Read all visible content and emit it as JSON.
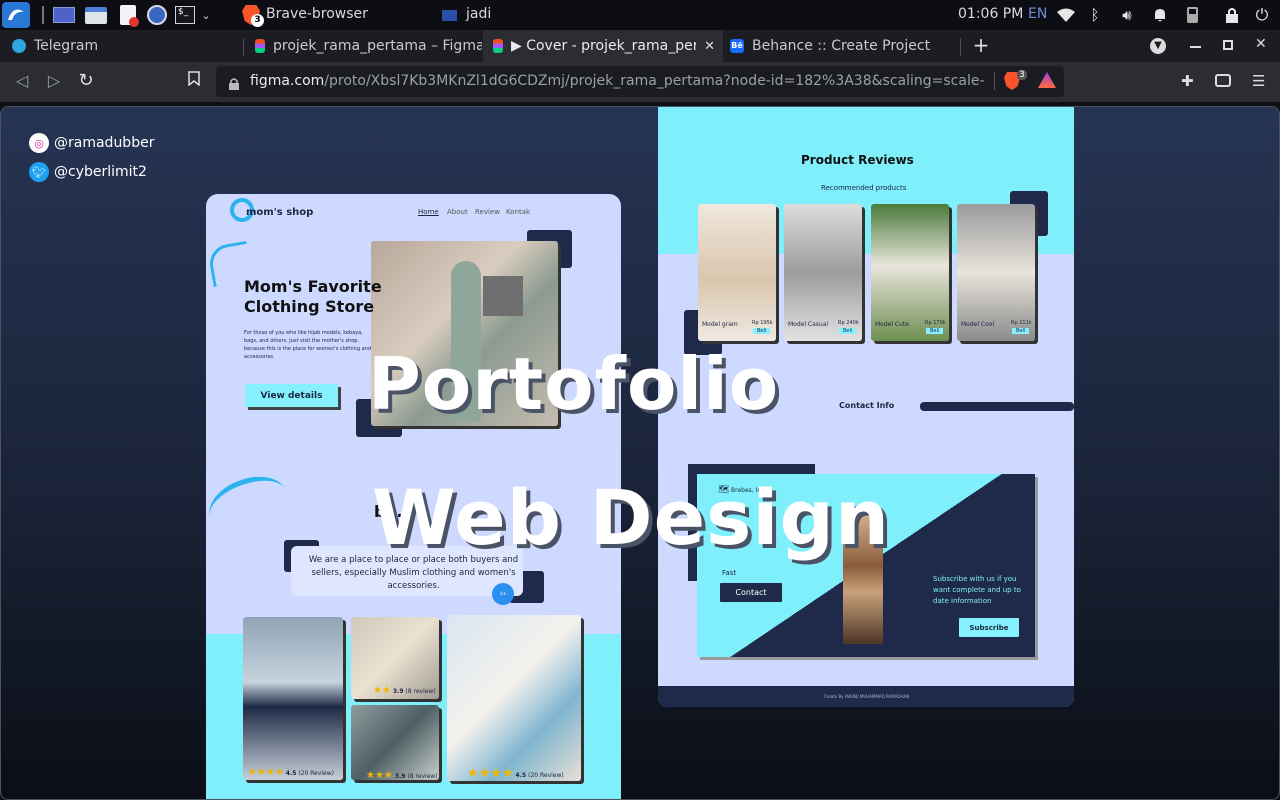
{
  "taskbar": {
    "app_window": "Brave-browser",
    "app_badge": "3",
    "second_window": "jadi",
    "clock": "01:06 PM",
    "lang": "EN"
  },
  "tabs": [
    {
      "label": "Telegram"
    },
    {
      "label": "projek_rama_pertama – Figma"
    },
    {
      "label": "▶ Cover - projek_rama_pertama"
    },
    {
      "label": "Behance :: Create Project"
    }
  ],
  "address": {
    "host": "figma.com",
    "path": "/proto/Xbsl7Kb3MKnZl1dG6CDZmj/projek_rama_pertama?node-id=182%3A38&scaling=scale-down-widt…",
    "shield_count": "3"
  },
  "slide": {
    "social_instagram": "@ramadubber",
    "social_twitter": "@cyberlimit2",
    "headline_1": "Portofolio",
    "headline_2": "Web Design",
    "left_page": {
      "brand": "mom's shop",
      "nav": [
        "Home",
        "About",
        "Review",
        "Kontak"
      ],
      "hero_title_1": "Mom's Favorite",
      "hero_title_2": "Clothing Store",
      "hero_body": "For those of you who like hijab models, kebaya, bags, and others, just visit the mother's shop. because this is the place for women's clothing and accessories.",
      "cta": "View details",
      "about_partial": "bo..",
      "about_body": "We are a place to place or place both buyers and sellers, especially Muslim clothing and women's accessories.",
      "ratings": [
        {
          "value": "4.5",
          "count": "(20 Review)"
        },
        {
          "value": "3.9",
          "count": "(8 review)"
        },
        {
          "value": "3.9",
          "count": "(8 review)"
        },
        {
          "value": "4.5",
          "count": "(20 Review)"
        }
      ]
    },
    "right_page": {
      "reviews_title": "Product Reviews",
      "reviews_sub": "Recommended products",
      "products": [
        {
          "name": "Model gram",
          "price": "Rp 195k",
          "btn": "Beli"
        },
        {
          "name": "Model Casual",
          "price": "Rp 240k",
          "btn": "Beli"
        },
        {
          "name": "Model Cute",
          "price": "Rp 170k",
          "btn": "Beli"
        },
        {
          "name": "Model Cool",
          "price": "Rp 211k",
          "btn": "Beli"
        }
      ],
      "contact_title": "Contact Info",
      "address": "Brebes, Ind...",
      "fast": "Fast",
      "contact_btn": "Contact",
      "subscribe_text": "Subscribe with us if you want complete and up to date information",
      "subscribe_btn": "Subscribe",
      "footer": "Create By AVENU MUHAMMAD RAMADHAN"
    }
  }
}
